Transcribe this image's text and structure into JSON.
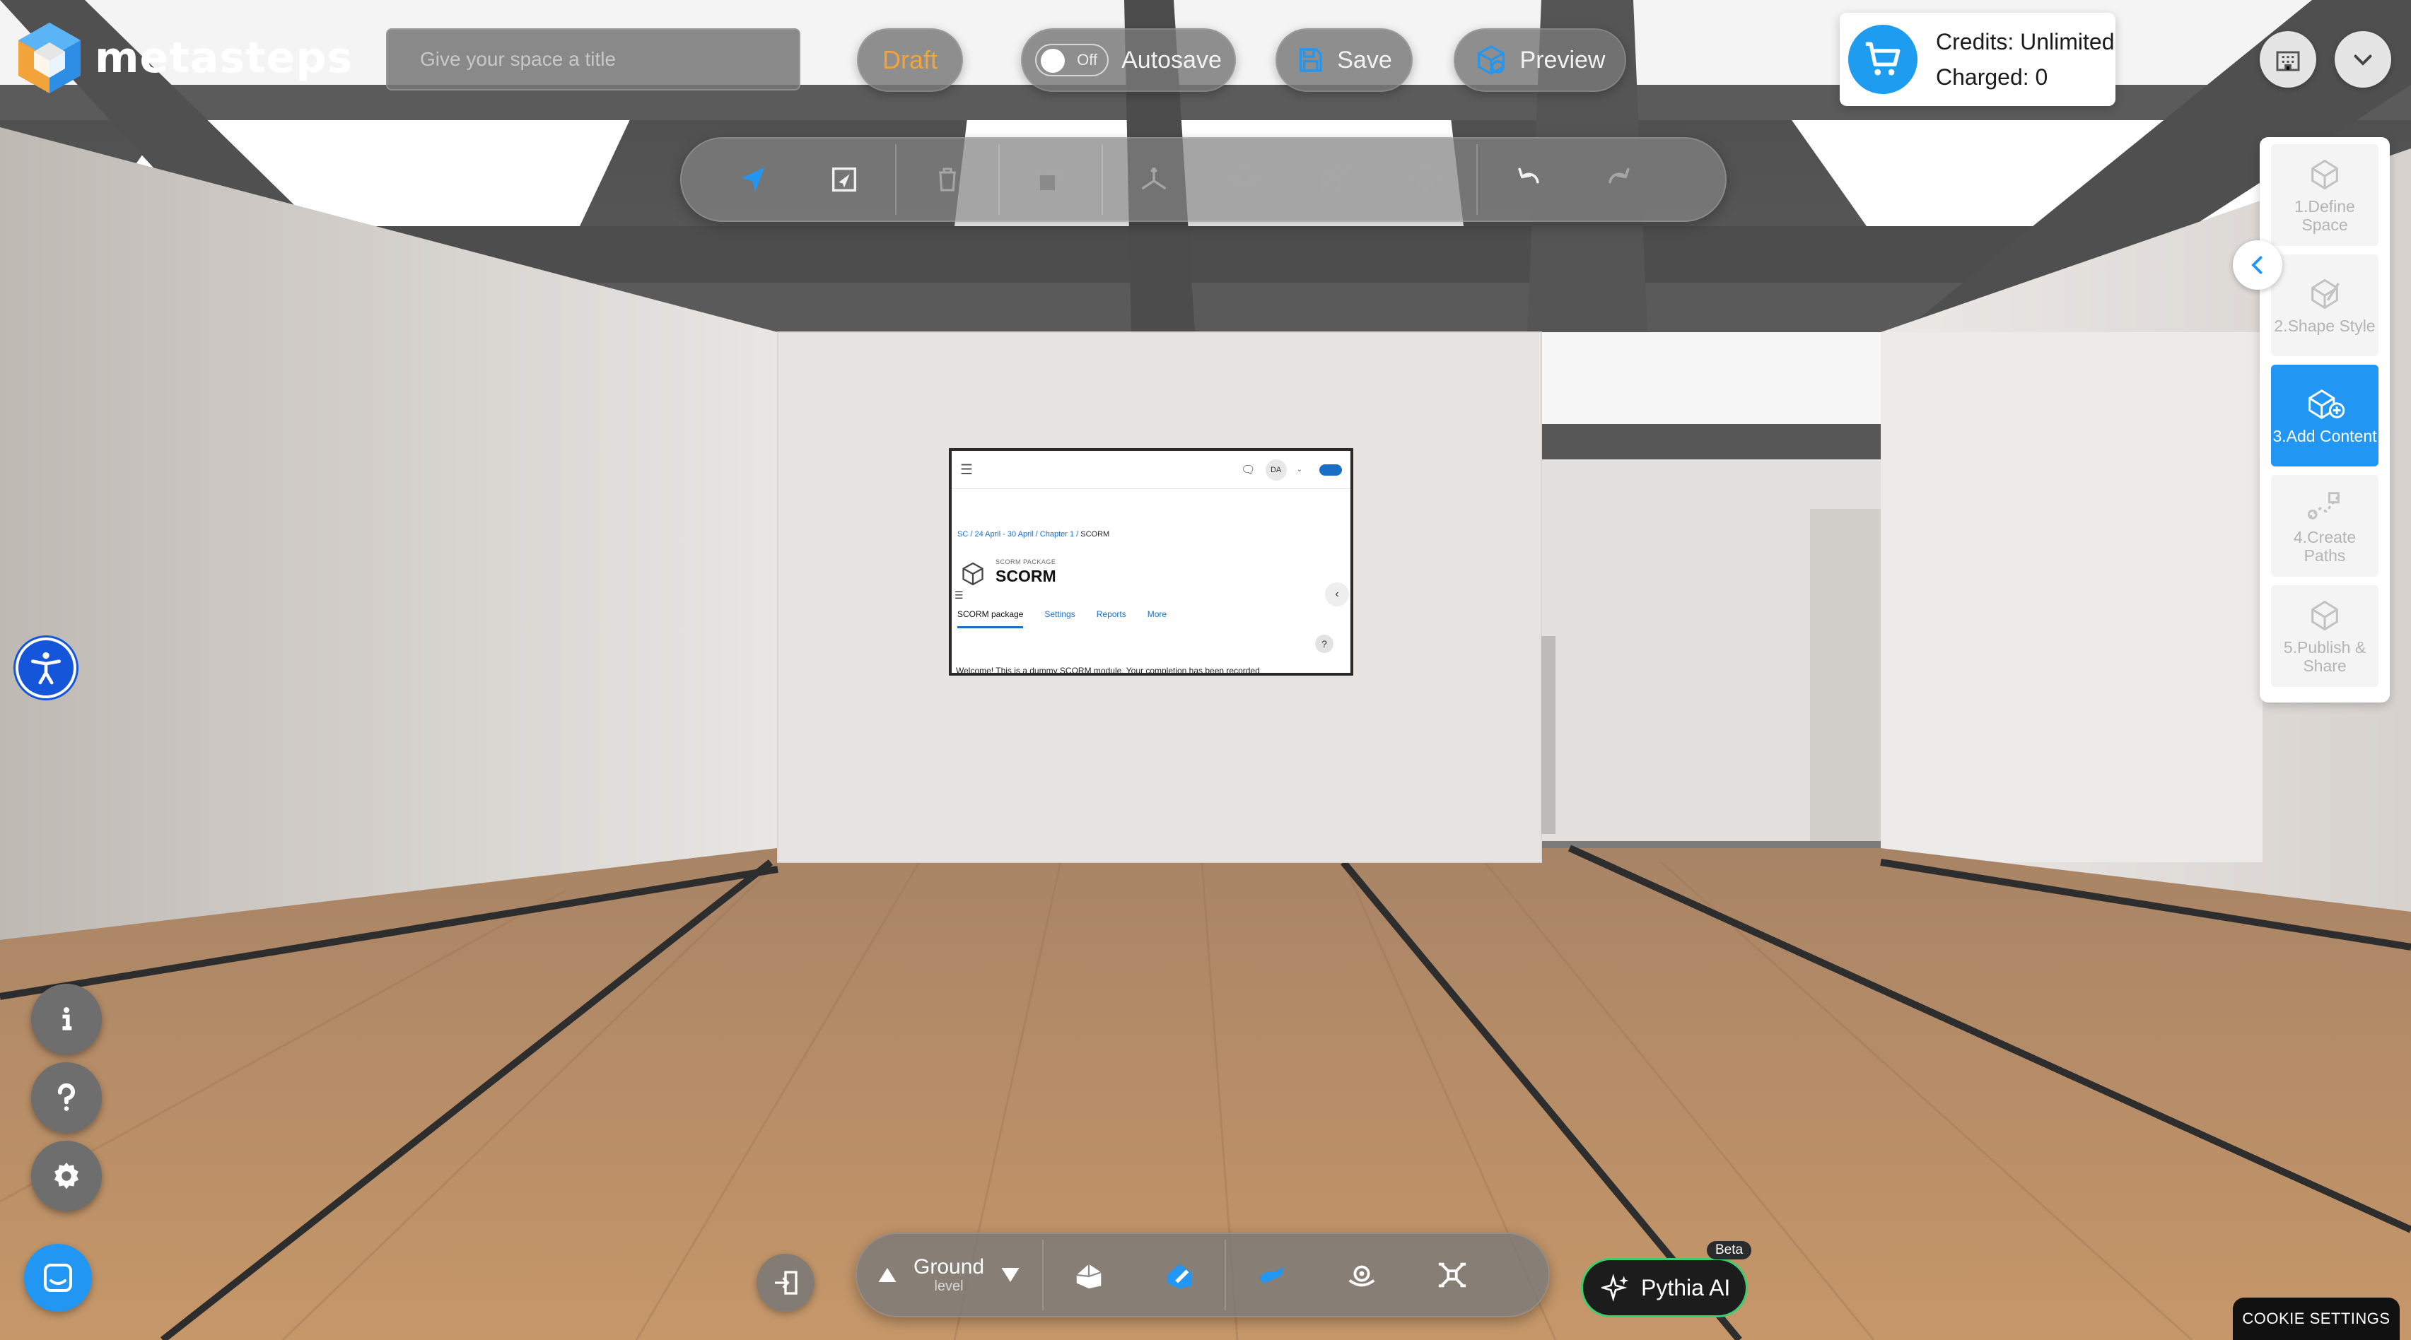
{
  "app": {
    "brand": "metasteps"
  },
  "header": {
    "title_placeholder": "Give your space a title",
    "status_label": "Draft",
    "autosave_toggle_label": "Off",
    "autosave_label": "Autosave",
    "save_label": "Save",
    "preview_label": "Preview",
    "credits_line": "Credits: Unlimited",
    "charged_line": "Charged: 0"
  },
  "toolbar": {
    "tools": [
      "select-arrow",
      "place-object",
      "delete",
      "duplicate",
      "move",
      "rotate",
      "scale",
      "pivot",
      "undo",
      "redo"
    ]
  },
  "steps": [
    {
      "label": "1.Define Space",
      "icon": "cube-define-icon"
    },
    {
      "label": "2.Shape Style",
      "icon": "cube-style-icon"
    },
    {
      "label": "3.Add Content",
      "icon": "cube-add-icon",
      "active": true
    },
    {
      "label": "4.Create Paths",
      "icon": "paths-icon"
    },
    {
      "label": "5.Publish & Share",
      "icon": "cube-publish-icon"
    }
  ],
  "bottom": {
    "level_name": "Ground",
    "level_sub": "level",
    "pythia_label": "Pythia AI",
    "beta_label": "Beta",
    "cookie_label": "COOKIE SETTINGS"
  },
  "screen": {
    "avatar": "DA",
    "breadcrumb": [
      "SC",
      "24 April - 30 April",
      "Chapter 1",
      "SCORM"
    ],
    "kicker": "SCORM PACKAGE",
    "title": "SCORM",
    "tabs": [
      "SCORM package",
      "Settings",
      "Reports",
      "More"
    ],
    "welcome": "Welcome! This is a dummy SCORM module. Your completion has been recorded"
  },
  "colors": {
    "accent": "#2196f3",
    "draft": "#f2a33a",
    "pythia_border": "#3ccf6f"
  }
}
